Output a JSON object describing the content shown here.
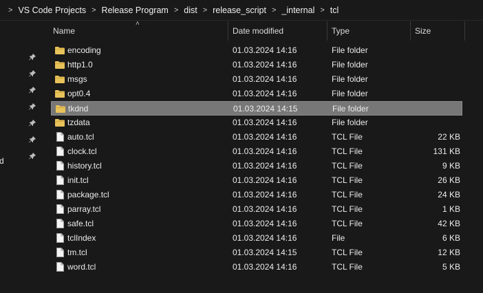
{
  "breadcrumb": [
    "VS Code Projects",
    "Release Program",
    "dist",
    "release_script",
    "_internal",
    "tcl"
  ],
  "nav": {
    "partial_label": "d"
  },
  "columns": {
    "name": "Name",
    "date": "Date modified",
    "type": "Type",
    "size": "Size"
  },
  "files": [
    {
      "name": "encoding",
      "date": "01.03.2024 14:16",
      "type": "File folder",
      "size": "",
      "kind": "folder"
    },
    {
      "name": "http1.0",
      "date": "01.03.2024 14:16",
      "type": "File folder",
      "size": "",
      "kind": "folder"
    },
    {
      "name": "msgs",
      "date": "01.03.2024 14:16",
      "type": "File folder",
      "size": "",
      "kind": "folder"
    },
    {
      "name": "opt0.4",
      "date": "01.03.2024 14:16",
      "type": "File folder",
      "size": "",
      "kind": "folder"
    },
    {
      "name": "tkdnd",
      "date": "01.03.2024 14:15",
      "type": "File folder",
      "size": "",
      "kind": "folder",
      "selected": true
    },
    {
      "name": "tzdata",
      "date": "01.03.2024 14:16",
      "type": "File folder",
      "size": "",
      "kind": "folder"
    },
    {
      "name": "auto.tcl",
      "date": "01.03.2024 14:16",
      "type": "TCL File",
      "size": "22 KB",
      "kind": "file"
    },
    {
      "name": "clock.tcl",
      "date": "01.03.2024 14:16",
      "type": "TCL File",
      "size": "131 KB",
      "kind": "file"
    },
    {
      "name": "history.tcl",
      "date": "01.03.2024 14:16",
      "type": "TCL File",
      "size": "9 KB",
      "kind": "file"
    },
    {
      "name": "init.tcl",
      "date": "01.03.2024 14:16",
      "type": "TCL File",
      "size": "26 KB",
      "kind": "file"
    },
    {
      "name": "package.tcl",
      "date": "01.03.2024 14:16",
      "type": "TCL File",
      "size": "24 KB",
      "kind": "file"
    },
    {
      "name": "parray.tcl",
      "date": "01.03.2024 14:16",
      "type": "TCL File",
      "size": "1 KB",
      "kind": "file"
    },
    {
      "name": "safe.tcl",
      "date": "01.03.2024 14:16",
      "type": "TCL File",
      "size": "42 KB",
      "kind": "file"
    },
    {
      "name": "tclIndex",
      "date": "01.03.2024 14:16",
      "type": "File",
      "size": "6 KB",
      "kind": "file"
    },
    {
      "name": "tm.tcl",
      "date": "01.03.2024 14:15",
      "type": "TCL File",
      "size": "12 KB",
      "kind": "file"
    },
    {
      "name": "word.tcl",
      "date": "01.03.2024 14:16",
      "type": "TCL File",
      "size": "5 KB",
      "kind": "file"
    }
  ],
  "colors": {
    "folder": "#e8c25a",
    "folder_dark": "#d4a83c",
    "selected": "#777777",
    "background": "#191919"
  }
}
